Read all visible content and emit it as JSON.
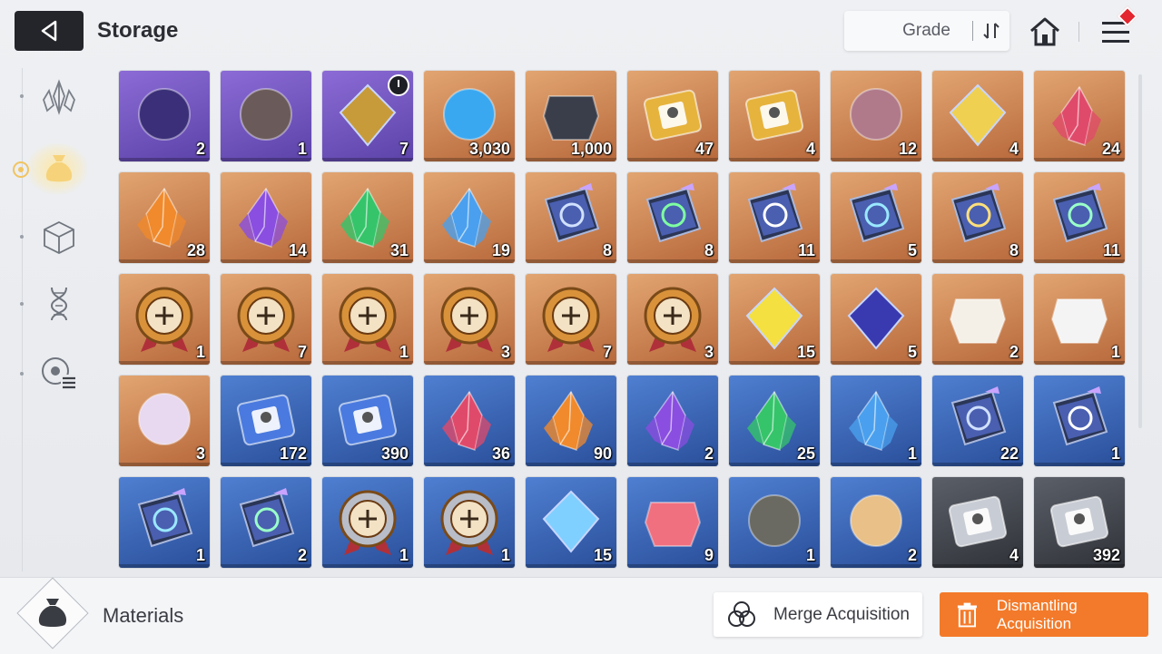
{
  "header": {
    "back_icon": "back-arrow-icon",
    "title": "Storage",
    "sort_label": "Grade",
    "sort_icon": "sort-arrows-icon",
    "home_icon": "home-icon",
    "menu_icon": "menu-icon"
  },
  "sidebar": {
    "items": [
      {
        "name": "crystal-category-icon",
        "active": false
      },
      {
        "name": "pouch-category-icon",
        "active": true
      },
      {
        "name": "cube-category-icon",
        "active": false
      },
      {
        "name": "dna-category-icon",
        "active": false
      },
      {
        "name": "list-category-icon",
        "active": false
      }
    ]
  },
  "items": [
    {
      "icon": "eye-cards-icon",
      "grade": "purple",
      "qty": "2"
    },
    {
      "icon": "dark-ore-icon",
      "grade": "purple",
      "qty": "1"
    },
    {
      "icon": "gold-triangle-icon",
      "grade": "purple",
      "qty": "7",
      "timer": true
    },
    {
      "icon": "blue-eye-orb-icon",
      "grade": "orange",
      "qty": "3,030"
    },
    {
      "icon": "chip-icon",
      "grade": "orange",
      "qty": "1,000"
    },
    {
      "icon": "gold-ticket-icon",
      "grade": "orange",
      "qty": "47"
    },
    {
      "icon": "gold-star-ticket-icon",
      "grade": "orange",
      "qty": "4"
    },
    {
      "icon": "purple-eye-rock-icon",
      "grade": "orange",
      "qty": "12"
    },
    {
      "icon": "gold-feather-icon",
      "grade": "orange",
      "qty": "4"
    },
    {
      "icon": "red-crystal-icon",
      "grade": "orange",
      "qty": "24"
    },
    {
      "icon": "orange-crystal-icon",
      "grade": "orange",
      "qty": "28"
    },
    {
      "icon": "purple-crystal-icon",
      "grade": "orange",
      "qty": "14"
    },
    {
      "icon": "green-crystal-icon",
      "grade": "orange",
      "qty": "31"
    },
    {
      "icon": "blue-crystal-icon",
      "grade": "orange",
      "qty": "19"
    },
    {
      "icon": "sword-book-icon",
      "grade": "orange",
      "qty": "8"
    },
    {
      "icon": "shield-book-icon",
      "grade": "orange",
      "qty": "8"
    },
    {
      "icon": "eye-book-icon",
      "grade": "orange",
      "qty": "11"
    },
    {
      "icon": "wing-book-icon",
      "grade": "orange",
      "qty": "5"
    },
    {
      "icon": "bolt-book-icon",
      "grade": "orange",
      "qty": "8"
    },
    {
      "icon": "rune-book-icon",
      "grade": "orange",
      "qty": "11"
    },
    {
      "icon": "sword-medal-icon",
      "grade": "orange",
      "qty": "1"
    },
    {
      "icon": "shield-medal-icon",
      "grade": "orange",
      "qty": "7"
    },
    {
      "icon": "eye-medal-icon",
      "grade": "orange",
      "qty": "1"
    },
    {
      "icon": "wing-medal-icon",
      "grade": "orange",
      "qty": "3"
    },
    {
      "icon": "bolt-medal-icon",
      "grade": "orange",
      "qty": "7"
    },
    {
      "icon": "rune-medal-icon",
      "grade": "orange",
      "qty": "3"
    },
    {
      "icon": "yellow-shards-icon",
      "grade": "orange",
      "qty": "15"
    },
    {
      "icon": "blue-cube-gem-icon",
      "grade": "orange",
      "qty": "5"
    },
    {
      "icon": "sneakers-icon",
      "grade": "orange",
      "qty": "2"
    },
    {
      "icon": "cards-stack-icon",
      "grade": "orange",
      "qty": "1"
    },
    {
      "icon": "guitar-pick-icon",
      "grade": "orange",
      "qty": "3"
    },
    {
      "icon": "blue-ticket-icon",
      "grade": "blue",
      "qty": "172"
    },
    {
      "icon": "blue-star-ticket-icon",
      "grade": "blue",
      "qty": "390"
    },
    {
      "icon": "red-crystal-icon",
      "grade": "blue",
      "qty": "36"
    },
    {
      "icon": "orange-crystal-icon",
      "grade": "blue",
      "qty": "90"
    },
    {
      "icon": "purple-crystal-icon",
      "grade": "blue",
      "qty": "2"
    },
    {
      "icon": "green-crystal-icon",
      "grade": "blue",
      "qty": "25"
    },
    {
      "icon": "blue-crystal-icon",
      "grade": "blue",
      "qty": "1"
    },
    {
      "icon": "sword-book-icon",
      "grade": "blue",
      "qty": "22"
    },
    {
      "icon": "eye-book-icon",
      "grade": "blue",
      "qty": "1"
    },
    {
      "icon": "wing-book-icon",
      "grade": "blue",
      "qty": "1"
    },
    {
      "icon": "rune-book-icon",
      "grade": "blue",
      "qty": "2"
    },
    {
      "icon": "sword-silver-medal-icon",
      "grade": "blue",
      "qty": "1"
    },
    {
      "icon": "eye-silver-medal-icon",
      "grade": "blue",
      "qty": "1"
    },
    {
      "icon": "ice-crystal-icon",
      "grade": "blue",
      "qty": "15"
    },
    {
      "icon": "cake-slice-icon",
      "grade": "blue",
      "qty": "9"
    },
    {
      "icon": "locket-icon",
      "grade": "blue",
      "qty": "1"
    },
    {
      "icon": "flower-bouquet-icon",
      "grade": "blue",
      "qty": "2"
    },
    {
      "icon": "silver-ticket-icon",
      "grade": "gray",
      "qty": "4"
    },
    {
      "icon": "silver-star-ticket-icon",
      "grade": "gray",
      "qty": "392"
    }
  ],
  "footer": {
    "category_icon": "pouch-icon",
    "category_label": "Materials",
    "merge_icon": "merge-circles-icon",
    "merge_label": "Merge Acquisition",
    "dismantle_icon": "trash-icon",
    "dismantle_label": "Dismantling Acquisition"
  },
  "colors": {
    "purple_grade": "#6f55c0",
    "orange_grade": "#cf8752",
    "blue_grade": "#3d66b6",
    "gray_grade": "#45484f",
    "dismantle_button": "#f37a2a",
    "active_category": "#f1c460"
  }
}
